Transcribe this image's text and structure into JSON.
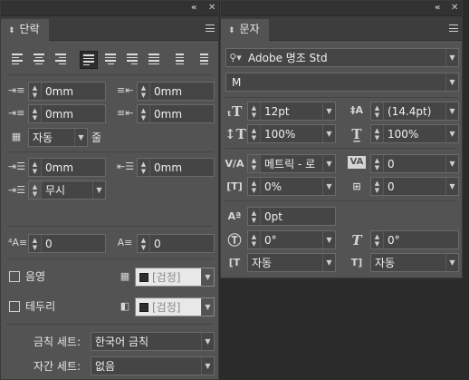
{
  "paragraph_panel": {
    "tab_label": "단락",
    "indent_left": "0mm",
    "indent_right": "0mm",
    "first_line_indent": "0mm",
    "last_line_indent": "0mm",
    "drop_cap_lines_select": "자동",
    "drop_cap_lines_label": "줄",
    "space_before": "0mm",
    "space_after": "0mm",
    "grid_align_select": "무시",
    "drop_cap_number": "0",
    "drop_cap_chars": "0",
    "shading_label": "음영",
    "shading_color": "[검정]",
    "border_label": "테두리",
    "border_color": "[검정]",
    "kinsoku_label": "금칙 세트:",
    "kinsoku_value": "한국어 금칙",
    "mojikumi_label": "자간 세트:",
    "mojikumi_value": "없음"
  },
  "character_panel": {
    "tab_label": "문자",
    "font_family": "Adobe 명조 Std",
    "font_style": "M",
    "font_size": "12pt",
    "leading": "(14.4pt)",
    "vertical_scale": "100%",
    "horizontal_scale": "100%",
    "kerning": "메트릭 - 로",
    "tracking": "0",
    "tsume": "0%",
    "aki": "0",
    "baseline_shift": "0pt",
    "rotation": "0°",
    "skew": "0°",
    "aki_before": "자동",
    "aki_after": "자동"
  },
  "window_controls": {
    "collapse": "«",
    "close": "✕"
  },
  "colors": {
    "panel_bg": "#535353",
    "tab_strip": "#3d3d3d",
    "field_bg": "#454545",
    "app_bg": "#2b2b2b"
  },
  "icons": [
    "chevron-up-down-icon",
    "panel-menu-icon",
    "align-left-icon",
    "align-center-icon",
    "align-right-icon",
    "justify-left-icon",
    "justify-all-icon",
    "search-icon",
    "dropdown-arrow-icon",
    "spinner-icon"
  ]
}
